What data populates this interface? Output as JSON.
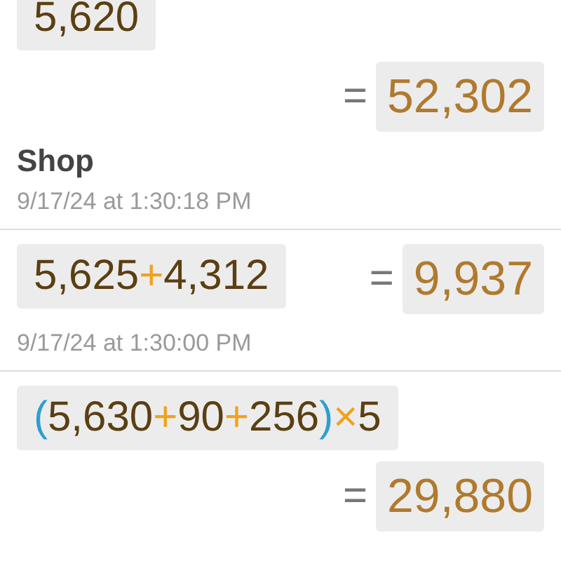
{
  "entries": [
    {
      "expression": [
        {
          "kind": "number",
          "text": "5,620"
        }
      ],
      "kind": "stacked",
      "equals": "=",
      "result": "52,302",
      "label": "Shop",
      "date": "9/17/24 at 1:30:18 PM"
    },
    {
      "expression": [
        {
          "kind": "number",
          "text": "5,625"
        },
        {
          "kind": "operator",
          "text": "+"
        },
        {
          "kind": "number",
          "text": "4,312"
        }
      ],
      "kind": "inline",
      "equals": "=",
      "result": "9,937",
      "date": "9/17/24 at 1:30:00 PM"
    },
    {
      "expression": [
        {
          "kind": "paren",
          "text": "("
        },
        {
          "kind": "number",
          "text": "5,630"
        },
        {
          "kind": "operator",
          "text": "+"
        },
        {
          "kind": "number",
          "text": "90"
        },
        {
          "kind": "operator",
          "text": "+"
        },
        {
          "kind": "number",
          "text": "256"
        },
        {
          "kind": "paren",
          "text": ")"
        },
        {
          "kind": "operator",
          "text": "×"
        },
        {
          "kind": "number",
          "text": "5"
        }
      ],
      "kind": "stacked",
      "equals": "=",
      "result": "29,880"
    }
  ]
}
